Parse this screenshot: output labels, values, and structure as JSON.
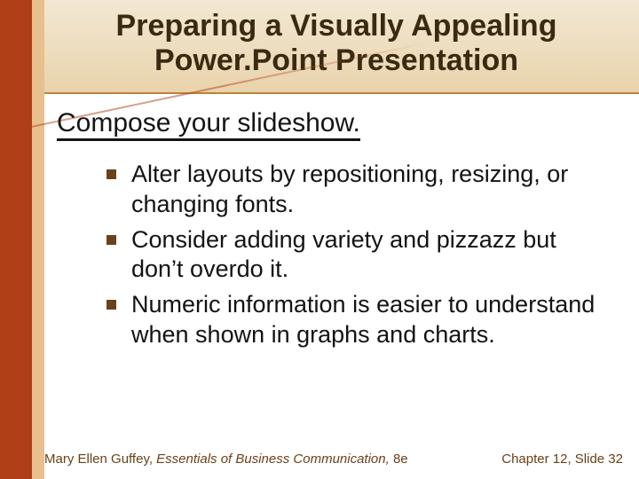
{
  "title_line1": "Preparing a Visually Appealing",
  "title_line2": "Power.Point Presentation",
  "subheading": "Compose your slideshow.",
  "bullets": [
    "Alter layouts by repositioning, resizing, or changing fonts.",
    "Consider adding variety and pizzazz but don’t overdo it.",
    "Numeric information is easier to understand when shown in graphs and charts."
  ],
  "footer": {
    "author": "Mary Ellen Guffey, ",
    "book": "Essentials of Business Communication, ",
    "edition": "8e",
    "chapter": "Chapter 12, Slide 32"
  },
  "colors": {
    "accent_dark": "#b03e17",
    "accent_light": "#e7c08d",
    "title_text": "#3a2a12",
    "bullet_square": "#6b411a",
    "footer_text": "#6a4119"
  }
}
